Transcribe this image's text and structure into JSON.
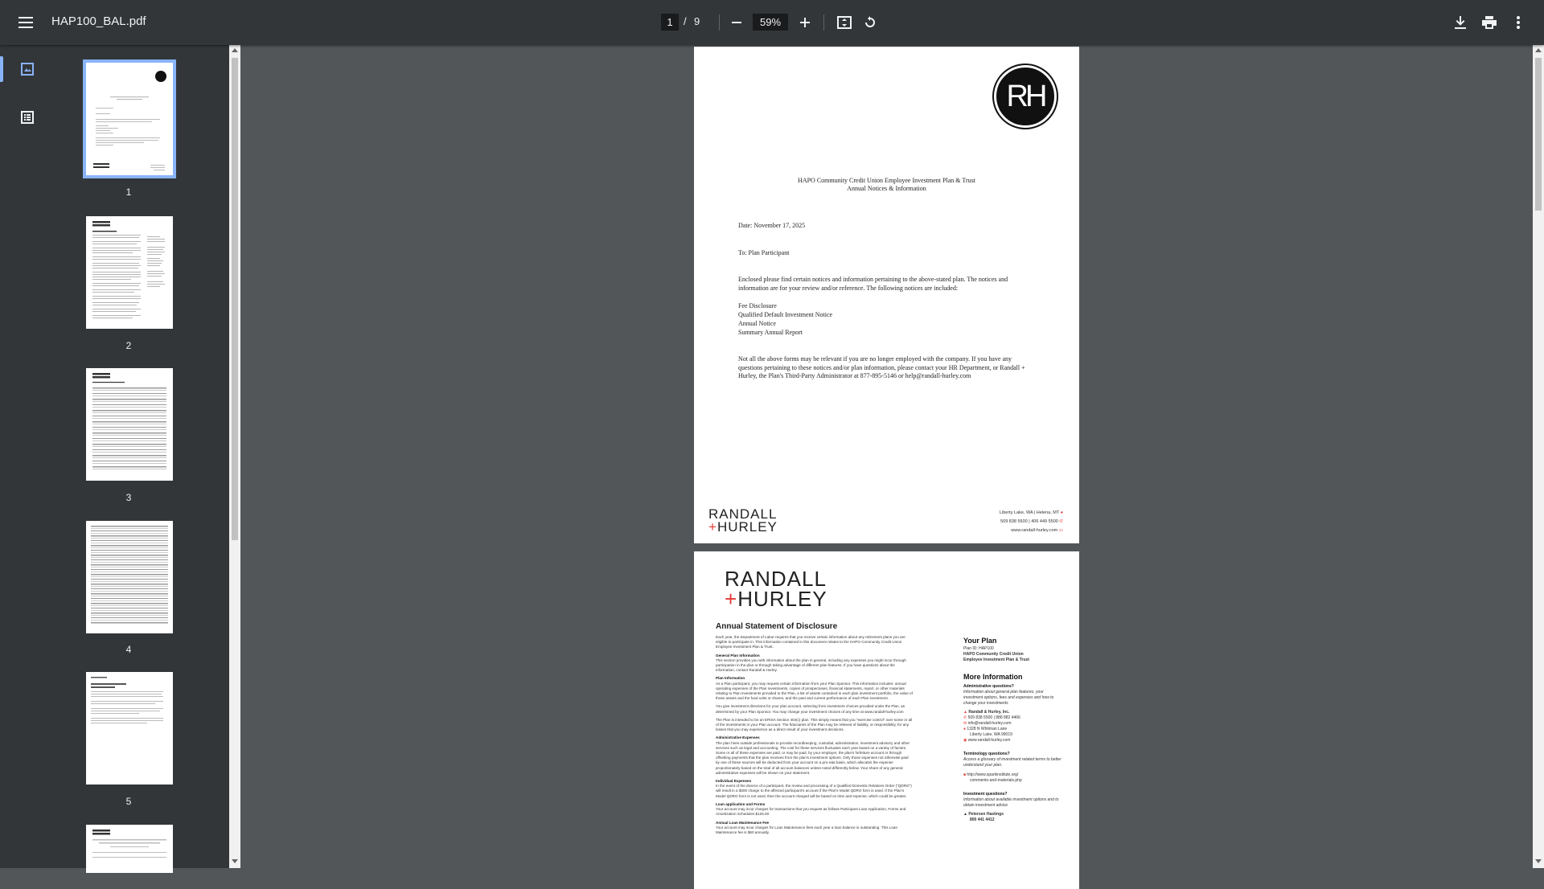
{
  "toolbar": {
    "filename": "HAP100_BAL.pdf",
    "current_page": "1",
    "page_separator": "/",
    "total_pages": "9",
    "zoom": "59%"
  },
  "thumbnails": [
    {
      "label": "1",
      "active": true
    },
    {
      "label": "2",
      "active": false
    },
    {
      "label": "3",
      "active": false
    },
    {
      "label": "4",
      "active": false
    },
    {
      "label": "5",
      "active": false
    }
  ],
  "page1": {
    "logo_text": "RH",
    "heading_line1": "HAPO Community Credit Union Employee Investment Plan & Trust",
    "heading_line2": "Annual Notices & Information",
    "date": "Date: November 17, 2025",
    "to": "To:  Plan Participant",
    "intro": "Enclosed please find certain notices and information pertaining to the above-stated plan. The notices and information are for your review and/or reference.  The following notices are included:",
    "notices": [
      "Fee Disclosure",
      "Qualified Default Investment Notice",
      "Annual Notice",
      "Summary Annual Report"
    ],
    "closing": "Not all the above forms may be relevant if you are no longer employed with the company. If you have any questions pertaining to these notices and/or plan information, please contact your HR Department, or Randall + Hurley, the Plan's Third-Party Administrator at 877-895-5146 or help@randall-hurley.com",
    "brand_line1": "RANDALL",
    "brand_line2": "HURLEY",
    "footer_location": "Liberty Lake, WA | Helena, MT",
    "footer_phone": "509 838 5500 | 406 449 5500",
    "footer_web": "www.randall-hurley.com"
  },
  "page2": {
    "brand_line1": "RANDALL",
    "brand_line2": "HURLEY",
    "title": "Annual Statement of Disclosure",
    "intro": "Each year, the Department of Labor requires that you receive certain information about any retirement plans you are eligible to participate in. This information contained in this document relates to the HAPO Community Credit Union Employee Investment Plan & Trust.",
    "sections": [
      {
        "heading": "General Plan Information",
        "text": "This section provides you with information about the plan in general, including any expenses you might incur through participation in the plan or through taking advantage of different plan features. If you have questions about the information, contact Randall & Hurley."
      },
      {
        "heading": "Plan Information",
        "text": "As a Plan participant, you may request certain information from your Plan Sponsor. This information includes: annual operating expenses of the Plan investments, copies of prospectuses, financial statements, report, or other materials relating to Plan investments provided to the Plan, a list of assets contained in each plan investment portfolio, the value of those assets and the fund units or shares, and the past and current performance of each Plan investment."
      },
      {
        "heading": "",
        "text": "You give investment directions for your plan account, selecting from investment choices provided under the Plan, as determined by your Plan Sponsor. You may change your investment choices of any time at www.randall-hurley.com"
      },
      {
        "heading": "",
        "text": "The Plan is intended to be an ERISA Section 404(c) plan. This simply means that you \"exercise control\" over some or all of the investments in your Plan account. The fiduciaries of the Plan may be relieved of liability, or responsibility, for any losses that you may experience as a direct result of your investment decisions."
      },
      {
        "heading": "Administrative Expenses",
        "text": "The plan hires outside professionals to provide recordkeeping, custodial, administration, investment advisory and other services such as legal and accounting. The cost for these services fluctuates each year based on a variety of factors. Some or all of these expenses are paid, or may be paid, by your employer, the plan's forfeiture account or through offsetting payments that the plan receives from the plan's investment options. Only those expenses not otherwise paid by one of these sources will be deducted from your account on a pro-rata basis, which allocates the expense proportionately based on the total of all account balances unless noted differently below. Your share of any general administrative expenses will be shown on your statement."
      },
      {
        "heading": "Individual Expenses",
        "text": "In the event of the divorce of a participant, the review and processing of a Qualified Domestic Relations Order (\"QDRO\") will result in a $300 charge to the affected participant's account if the Plan's Model QDRO form is used. If the Plan's Model QDRO form is not used, then the account charged will be based on time and expense, which could be greater."
      },
      {
        "heading": "Loan application and Forms",
        "text": "Your account may incur charges for transactions that you request as follows Participant Loan Application, Forms and Amortization Schedules $125.00"
      },
      {
        "heading": "Annual Loan Maintenance Fee",
        "text": "Your account may incur charges for Loan Maintenance fees each year a loan balance is outstanding. This Loan Maintenance fee is $60 annually."
      }
    ],
    "your_plan_heading": "Your Plan",
    "plan_id": "Plan ID:     HAP100",
    "plan_name_1": "HAPO Community Credit Union",
    "plan_name_2": "Employee Investment Plan & Trust",
    "more_info_heading": "More Information",
    "admin_q": "Administrative questions?",
    "admin_q_text": "Information about general plan features, your investment options, fees and expenses and how to change your investments",
    "company": "Randall & Hurley, Inc.",
    "phones": "509 838 5500 | 888 882 4466",
    "email": "info@randall-hurley.com",
    "address1": "1328 N Whitman Lane",
    "address2": "Liberty Lake, WA 99019",
    "website": "www.randall-hurley.com",
    "term_q": "Terminology questions?",
    "term_q_text": "Access a glossary of investment related terms to better understand your plan.",
    "term_url1": "http://www.sparkinstitute.org/",
    "term_url2": "comments-and-materials.php",
    "invest_q": "Investment questions?",
    "invest_q_text": "Information about available investment options and to obtain investment advice",
    "advisor": "Petersen Hastings",
    "advisor_phone": "800 441 4412"
  }
}
